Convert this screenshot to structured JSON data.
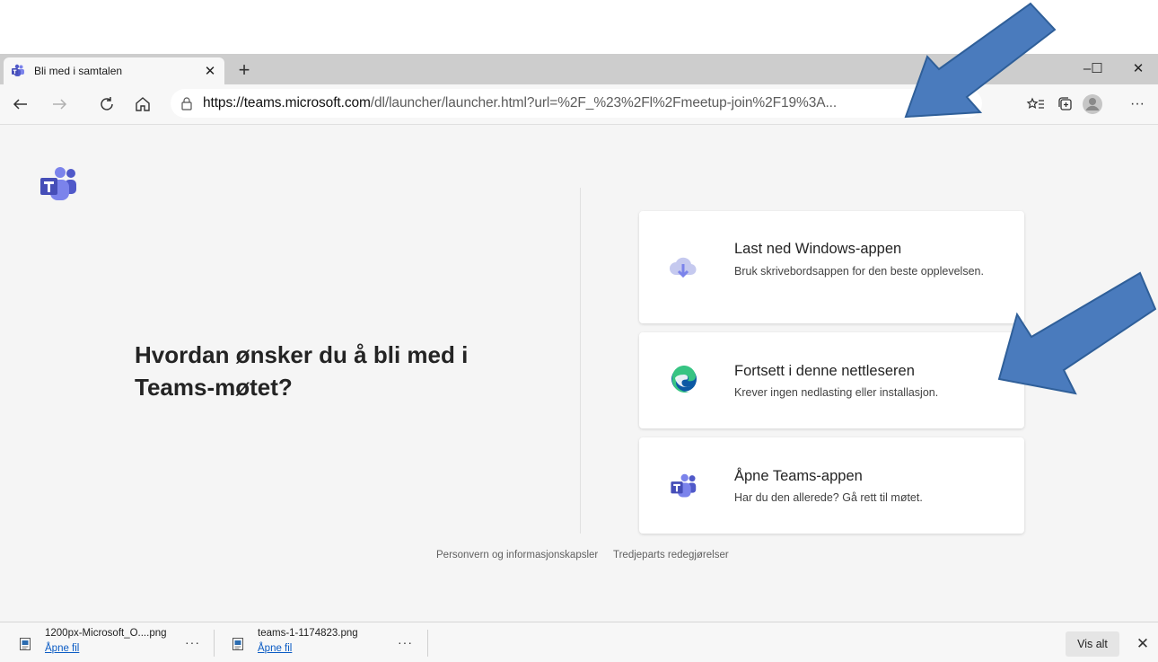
{
  "browser": {
    "tab_title": "Bli med i samtalen",
    "close_tab": "✕",
    "new_tab": "+",
    "minimize": "–",
    "maximize": "☐",
    "close_window": "✕",
    "url_domain": "https://teams.microsoft.com",
    "url_path": "/dl/launcher/launcher.html?url=%2F_%23%2Fl%2Fmeetup-join%2F19%3A...",
    "more": "···"
  },
  "main": {
    "heading": "Hvordan ønsker du å bli med i Teams-møtet?",
    "options": [
      {
        "title": "Last ned Windows-appen",
        "description": "Bruk skrivebordsappen for den beste opplevelsen."
      },
      {
        "title": "Fortsett i denne nettleseren",
        "description": "Krever ingen nedlasting eller installasjon."
      },
      {
        "title": "Åpne Teams-appen",
        "description": "Har du den allerede? Gå rett til møtet."
      }
    ],
    "footer": {
      "privacy": "Personvern og informasjonskapsler",
      "third_party": "Tredjeparts redegjørelser"
    }
  },
  "downloads": {
    "items": [
      {
        "name": "1200px-Microsoft_O....png",
        "action": "Åpne fil",
        "more": "···"
      },
      {
        "name": "teams-1-1174823.png",
        "action": "Åpne fil",
        "more": "···"
      }
    ],
    "show_all": "Vis alt",
    "close": "✕"
  },
  "colors": {
    "teams_purple": "#5059c9",
    "teams_dark": "#464eb8",
    "arrow_blue": "#4a7bbd",
    "edge_blue": "#0c59a4",
    "edge_green": "#37c483"
  }
}
